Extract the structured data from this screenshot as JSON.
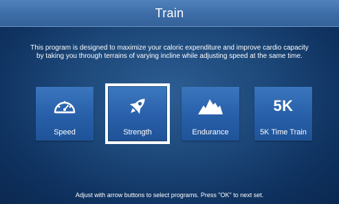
{
  "header": {
    "title": "Train"
  },
  "description": {
    "line1": "This program is designed to maximize your caloric expenditure and improve cardio capacity",
    "line2": "by taking you through terrains of varying incline while adjusting speed at the same time."
  },
  "programs": [
    {
      "label": "Speed",
      "icon": "speedometer-icon",
      "selected": false
    },
    {
      "label": "Strength",
      "icon": "rocket-icon",
      "selected": true
    },
    {
      "label": "Endurance",
      "icon": "mountain-icon",
      "selected": false
    },
    {
      "label": "5K Time Train",
      "icon": "5k-text-icon",
      "icon_text": "5K",
      "selected": false
    }
  ],
  "footer": {
    "text": "Adjust with arrow buttons to select programs. Press \"OK\" to next set."
  },
  "colors": {
    "header_bar": "#3d6ca6",
    "tile": "#275fa8",
    "background": "#1b4677",
    "selection": "#ffffff"
  }
}
